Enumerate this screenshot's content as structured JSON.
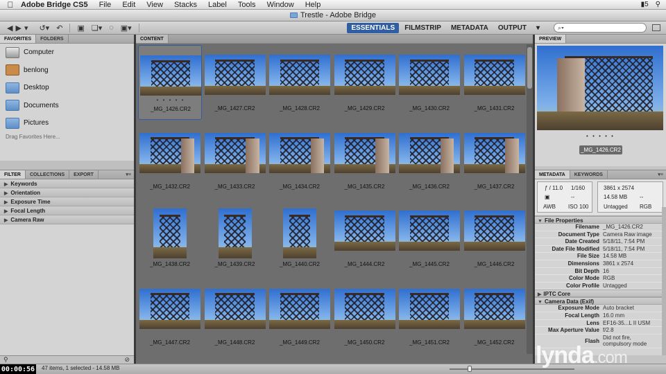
{
  "menubar": {
    "app": "Adobe Bridge CS5",
    "menus": [
      "File",
      "Edit",
      "View",
      "Stacks",
      "Label",
      "Tools",
      "Window",
      "Help"
    ],
    "badge": "5"
  },
  "window": {
    "title": "Trestle - Adobe Bridge"
  },
  "toolbar": {
    "workspaces": [
      "ESSENTIALS",
      "FILMSTRIP",
      "METADATA",
      "OUTPUT"
    ],
    "active_workspace": "ESSENTIALS",
    "search_placeholder": "⌕▾"
  },
  "left": {
    "tabs": [
      "FAVORITES",
      "FOLDERS"
    ],
    "favorites": [
      {
        "label": "Computer",
        "icon": "computer-icon"
      },
      {
        "label": "benlong",
        "icon": "home-icon"
      },
      {
        "label": "Desktop",
        "icon": "folder-icon"
      },
      {
        "label": "Documents",
        "icon": "folder-icon"
      },
      {
        "label": "Pictures",
        "icon": "folder-icon"
      }
    ],
    "hint": "Drag Favorites Here...",
    "filter_tabs": [
      "FILTER",
      "COLLECTIONS",
      "EXPORT"
    ],
    "filters": [
      "Keywords",
      "Orientation",
      "Exposure Time",
      "Focal Length",
      "Camera Raw"
    ]
  },
  "content": {
    "tab": "CONTENT",
    "items": [
      {
        "name": "_MG_1426.CR2",
        "selected": true,
        "portrait": false
      },
      {
        "name": "_MG_1427.CR2",
        "portrait": false
      },
      {
        "name": "_MG_1428.CR2",
        "portrait": false
      },
      {
        "name": "_MG_1429.CR2",
        "portrait": false
      },
      {
        "name": "_MG_1430.CR2",
        "portrait": false
      },
      {
        "name": "_MG_1431.CR2",
        "portrait": false
      },
      {
        "name": "_MG_1432.CR2",
        "portrait": false
      },
      {
        "name": "_MG_1433.CR2",
        "portrait": false
      },
      {
        "name": "_MG_1434.CR2",
        "portrait": false
      },
      {
        "name": "_MG_1435.CR2",
        "portrait": false
      },
      {
        "name": "_MG_1436.CR2",
        "portrait": false
      },
      {
        "name": "_MG_1437.CR2",
        "portrait": false
      },
      {
        "name": "_MG_1438.CR2",
        "portrait": true
      },
      {
        "name": "_MG_1439.CR2",
        "portrait": true
      },
      {
        "name": "_MG_1440.CR2",
        "portrait": true
      },
      {
        "name": "_MG_1444.CR2",
        "portrait": false
      },
      {
        "name": "_MG_1445.CR2",
        "portrait": false
      },
      {
        "name": "_MG_1446.CR2",
        "portrait": false
      },
      {
        "name": "_MG_1447.CR2",
        "portrait": false
      },
      {
        "name": "_MG_1448.CR2",
        "portrait": false
      },
      {
        "name": "_MG_1449.CR2",
        "portrait": false
      },
      {
        "name": "_MG_1450.CR2",
        "portrait": false
      },
      {
        "name": "_MG_1451.CR2",
        "portrait": false
      },
      {
        "name": "_MG_1452.CR2",
        "portrait": false
      }
    ],
    "rating_dots": "• • • • •"
  },
  "right": {
    "preview_tab": "PREVIEW",
    "preview_name": "_MG_1426.CR2",
    "meta_tabs": [
      "METADATA",
      "KEYWORDS"
    ],
    "header": {
      "aperture": "ƒ / 11.0",
      "shutter": "1/160",
      "ev": "--",
      "iso": "ISO 100",
      "wb": "AWB",
      "dimensions": "3861 x 2574",
      "size": "14.58 MB",
      "tagged": "Untagged",
      "mode": "RGB"
    },
    "sections": {
      "file_properties": "File Properties",
      "iptc": "IPTC Core",
      "camera": "Camera Data (Exif)"
    },
    "file_props": [
      {
        "k": "Filename",
        "v": "_MG_1426.CR2"
      },
      {
        "k": "Document Type",
        "v": "Camera Raw image"
      },
      {
        "k": "Date Created",
        "v": "5/18/11, 7:54 PM"
      },
      {
        "k": "Date File Modified",
        "v": "5/18/11, 7:54 PM"
      },
      {
        "k": "File Size",
        "v": "14.58 MB"
      },
      {
        "k": "Dimensions",
        "v": "3861 x 2574"
      },
      {
        "k": "Bit Depth",
        "v": "16"
      },
      {
        "k": "Color Mode",
        "v": "RGB"
      },
      {
        "k": "Color Profile",
        "v": "Untagged"
      }
    ],
    "camera_props": [
      {
        "k": "Exposure Mode",
        "v": "Auto bracket"
      },
      {
        "k": "Focal Length",
        "v": "16.0 mm"
      },
      {
        "k": "Lens",
        "v": "EF16-35...L II USM"
      },
      {
        "k": "Max Aperture Value",
        "v": "f/2.8"
      }
    ],
    "flash": {
      "k": "Flash",
      "v1": "Did not fire,",
      "v2": "compulsory mode"
    }
  },
  "status": {
    "text": "47 items, 1 selected - 14.58 MB",
    "timecode": "00:00:56",
    "watermark": "lynda",
    "watermark_suffix": ".com"
  }
}
